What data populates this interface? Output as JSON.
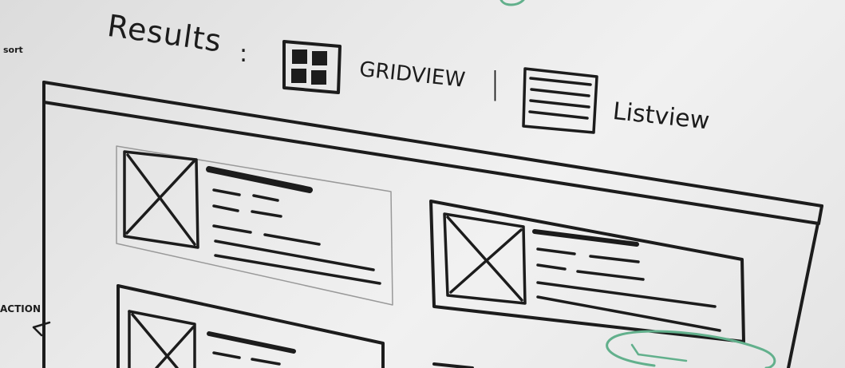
{
  "results_label": "Results",
  "colon": ":",
  "grid_view_label": "GRIDVIEW",
  "separator": "|",
  "list_view_label": "Listview",
  "margin_note_top": "sort",
  "margin_note_left": "ACTION",
  "colors": {
    "ink": "#1c1c1c",
    "highlight": "#62b08c",
    "paper": "#ececec"
  },
  "icons": {
    "grid": "grid-view-icon",
    "list": "list-view-icon",
    "image": "image-placeholder-icon"
  }
}
